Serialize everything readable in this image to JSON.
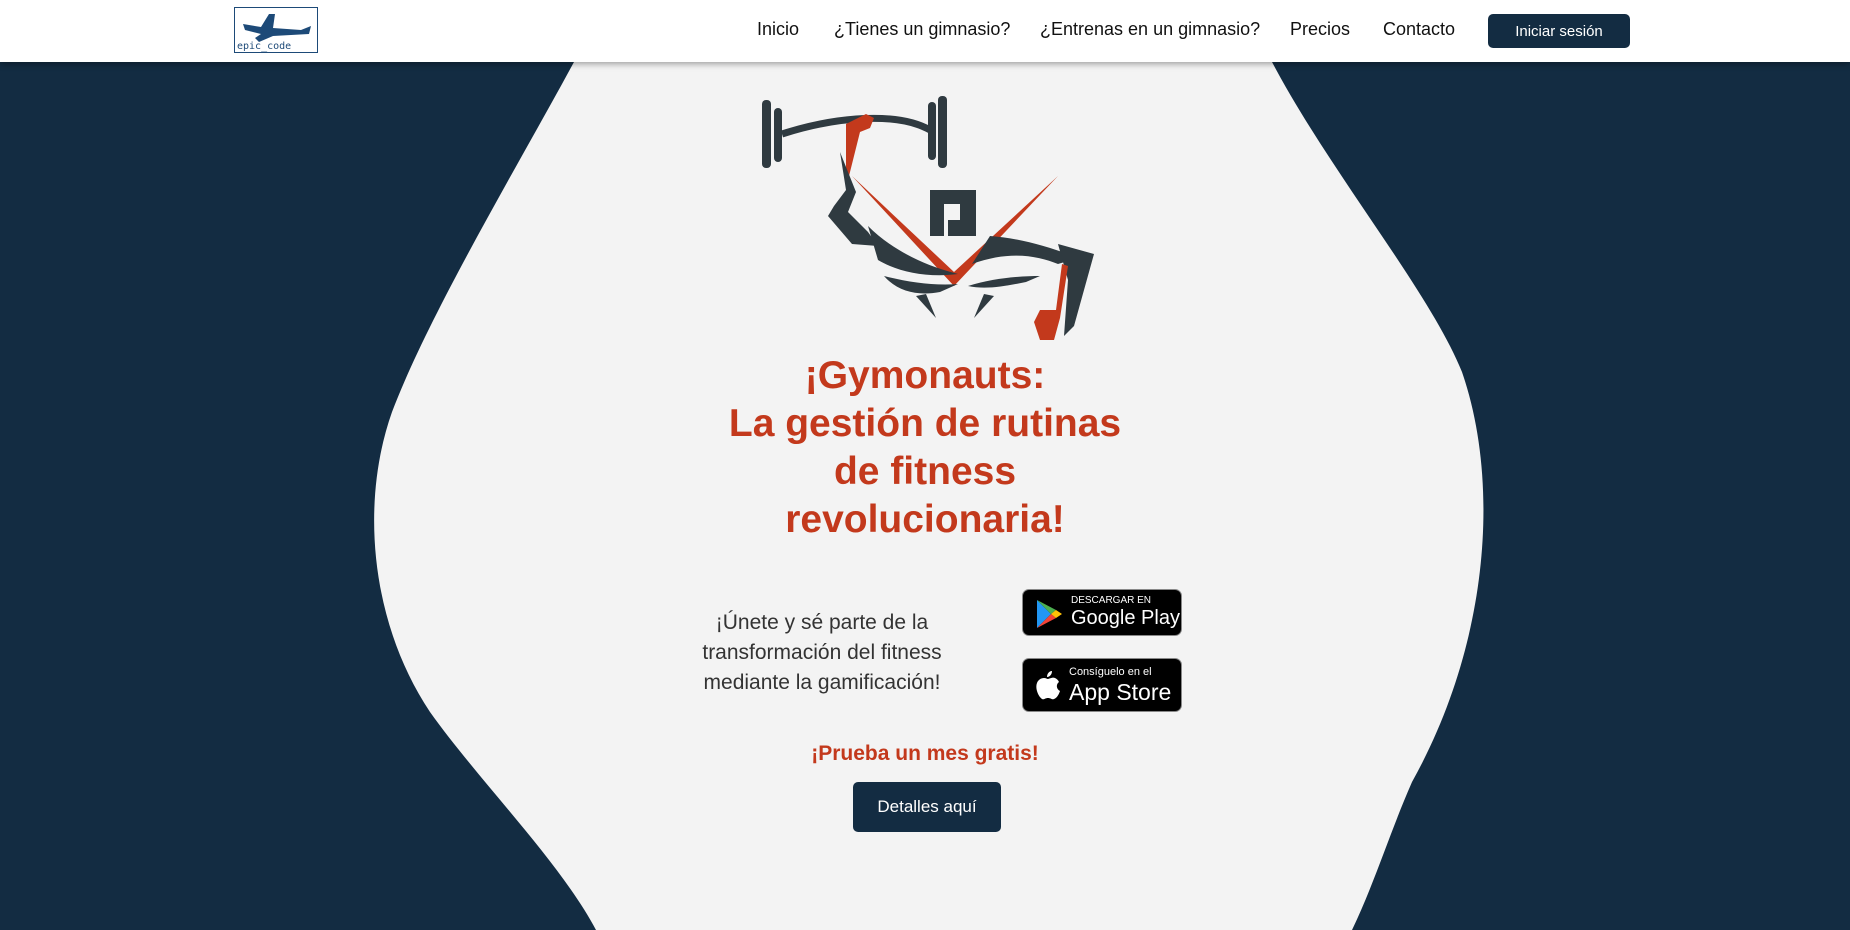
{
  "brand": {
    "logo_text": "epic_code"
  },
  "nav": {
    "items": [
      {
        "label": "Inicio"
      },
      {
        "label": "¿Tienes un gimnasio?"
      },
      {
        "label": "¿Entrenas en un gimnasio?"
      },
      {
        "label": "Precios"
      },
      {
        "label": "Contacto"
      }
    ],
    "login_label": "Iniciar sesión"
  },
  "hero": {
    "headline_lines": [
      "¡Gymonauts:",
      "La gestión de rutinas",
      "de fitness",
      "revolucionaria!"
    ],
    "tagline": "¡Únete y sé parte de la transformación del fitness mediante la gamificación!",
    "google_play": {
      "small": "DESCARGAR EN",
      "big": "Google Play"
    },
    "app_store": {
      "small": "Consíguelo en el",
      "big": "App Store"
    },
    "promo": "¡Prueba un mes gratis!",
    "details_label": "Detalles aquí"
  },
  "colors": {
    "navy": "#132c42",
    "accent": "#c3391c",
    "light": "#f3f3f3",
    "logo_dark": "#2f3a40"
  },
  "icons": [
    "logo-plane-icon",
    "gymonauts-logo-icon",
    "google-play-icon",
    "apple-icon"
  ]
}
